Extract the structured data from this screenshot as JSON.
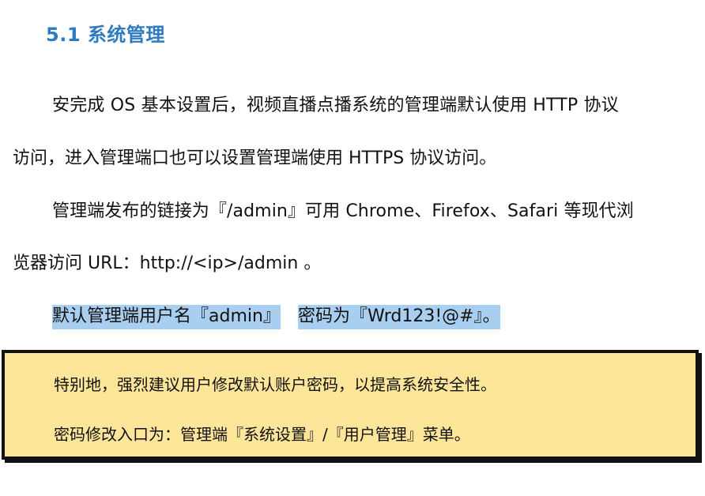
{
  "section": {
    "heading": "5.1 系统管理"
  },
  "paragraphs": {
    "p1_line1": "安完成  OS  基本设置后，视频直播点播系统的管理端默认使用  HTTP 协议",
    "p1_line2": "访问，进入管理端口也可以设置管理端使用  HTTPS  协议访问。",
    "p2_line1": "管理端发布的链接为『/admin』可用 Chrome、Firefox、Safari  等现代浏",
    "p2_line2": "览器访问 URL：http://<ip>/admin  。",
    "credentials_part1": "默认管理端用户名『admin』",
    "credentials_part2": "密码为『Wrd123!@#』。"
  },
  "notice": {
    "line1": "特别地，强烈建议用户修改默认账户密码，以提高系统安全性。",
    "line2": "密码修改入口为：管理端『系统设置』/『用户管理』菜单。"
  },
  "colors": {
    "heading": "#2e7bbf",
    "highlight": "#a9cff0",
    "notice_background": "#fde59a",
    "notice_border": "#111111"
  }
}
